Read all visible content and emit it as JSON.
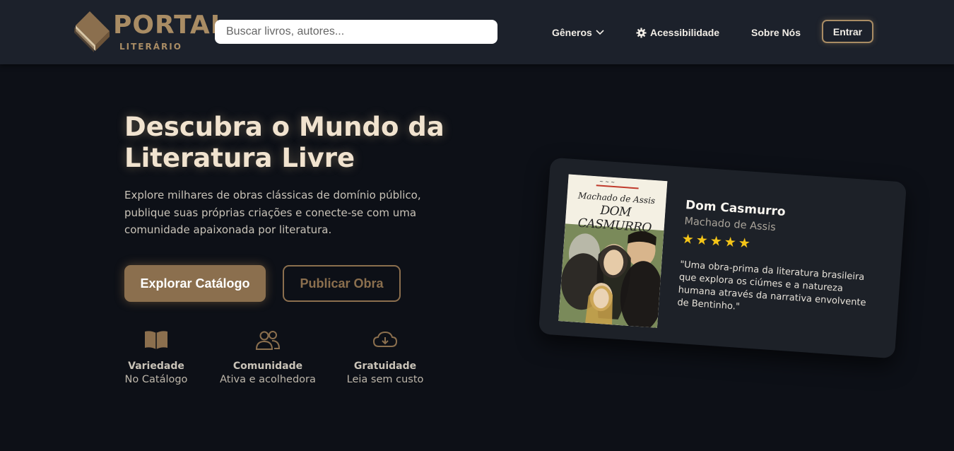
{
  "header": {
    "logo_title": "PORTAL",
    "logo_subtitle": "LITERÁRIO",
    "search_placeholder": "Buscar livros, autores...",
    "nav": {
      "generos": "Gêneros",
      "acessibilidade": "Acessibilidade",
      "sobre": "Sobre Nós"
    },
    "login_label": "Entrar"
  },
  "hero": {
    "title": "Descubra o Mundo da Literatura Livre",
    "description": "Explore milhares de obras clássicas de domínio público, publique suas próprias criações e conecte-se com uma comunidade apaixonada por literatura.",
    "primary_button": "Explorar Catálogo",
    "secondary_button": "Publicar Obra"
  },
  "features": [
    {
      "icon": "book-open-icon",
      "title": "Variedade",
      "subtitle": "No Catálogo"
    },
    {
      "icon": "users-icon",
      "title": "Comunidade",
      "subtitle": "Ativa e acolhedora"
    },
    {
      "icon": "cloud-download-icon",
      "title": "Gratuidade",
      "subtitle": "Leia sem custo"
    }
  ],
  "featured_book": {
    "cover_author": "Machado de Assis",
    "cover_title": "DOM CASMURRO",
    "title": "Dom Casmurro",
    "author": "Machado de Assis",
    "rating": 5,
    "rating_max": 5,
    "quote": "\"Uma obra-prima da literatura brasileira que explora os ciúmes e a natureza humana através da narrativa envolvente de Bentinho.\""
  },
  "colors": {
    "background": "#0d1017",
    "header": "#1c212b",
    "accent": "#8b6f4e",
    "logo": "#a98c64",
    "star": "#f5c518"
  }
}
